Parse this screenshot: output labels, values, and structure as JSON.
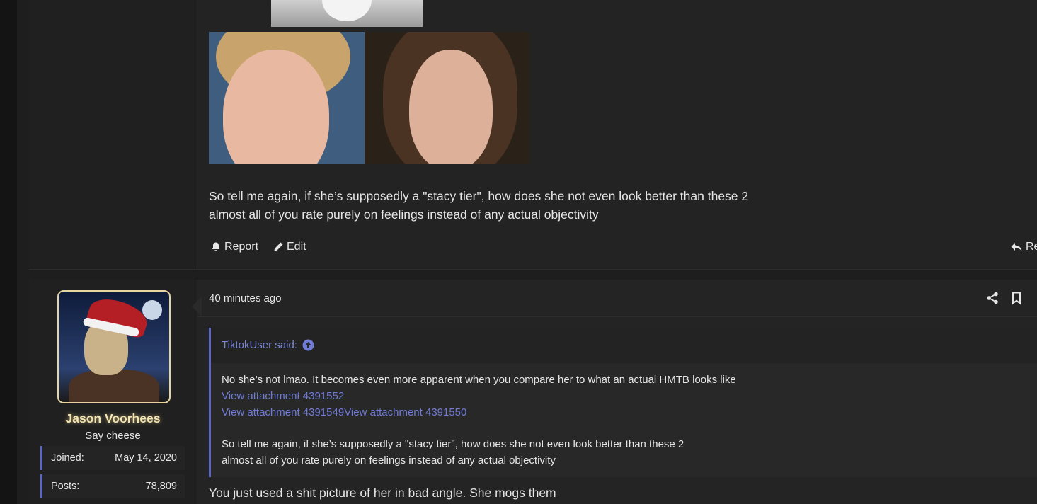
{
  "post_previous": {
    "body_line1": "So tell me again, if she’s supposedly a \"stacy tier\", how does she not even look better than these 2",
    "body_line2": "almost all of you rate purely on feelings instead of any actual objectivity",
    "actions": {
      "report": "Report",
      "edit": "Edit",
      "reply": "Re"
    },
    "icons": {
      "report": "bell-icon",
      "edit": "pencil-icon",
      "reply": "reply-arrow-icon"
    }
  },
  "post_current": {
    "author": {
      "name": "Jason Voorhees",
      "title": "Say cheese",
      "stats": [
        {
          "label": "Joined:",
          "value": "May 14, 2020"
        },
        {
          "label": "Posts:",
          "value": "78,809"
        }
      ]
    },
    "timestamp": "40 minutes ago",
    "header_icons": [
      "share-icon",
      "bookmark-icon"
    ],
    "quote": {
      "author_label": "TiktokUser said:",
      "author_icon": "arrow-up-circle-icon",
      "line1": "No she’s not lmao. It becomes even more apparent when you compare her to what an actual HMTB looks like",
      "link1": "View attachment 4391552",
      "link2": "View attachment 4391549",
      "link3": "View attachment 4391550",
      "line3": "So tell me again, if she’s supposedly a \"stacy tier\", how does she not even look better than these 2",
      "line4": "almost all of you rate purely on feelings instead of any actual objectivity"
    },
    "reply_text": "You just used a shit picture of her in bad angle. She mogs them"
  },
  "colors": {
    "accent": "#5b66c6",
    "link": "#6f7bd6",
    "username_glow": "#f2e3b2",
    "background": "#1e1e1e"
  }
}
